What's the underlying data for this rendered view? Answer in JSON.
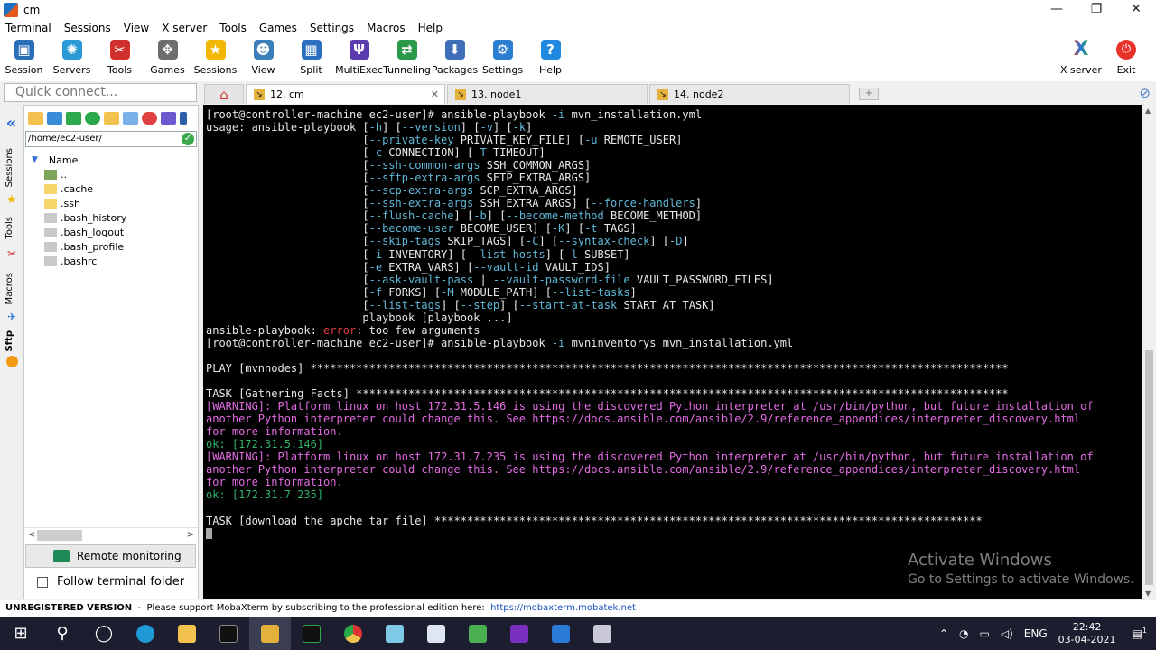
{
  "window": {
    "title": "cm",
    "minimize": "—",
    "maximize": "❐",
    "close": "✕"
  },
  "menu": [
    "Terminal",
    "Sessions",
    "View",
    "X server",
    "Tools",
    "Games",
    "Settings",
    "Macros",
    "Help"
  ],
  "toolbar": {
    "items": [
      {
        "label": "Session",
        "icon": "session-icon",
        "color": "#2a6fb5",
        "glyph": "▣"
      },
      {
        "label": "Servers",
        "icon": "servers-icon",
        "color": "#2b9bd6",
        "glyph": "✺"
      },
      {
        "label": "Tools",
        "icon": "tools-icon",
        "color": "#d0312d",
        "glyph": "✂"
      },
      {
        "label": "Games",
        "icon": "games-icon",
        "color": "#6e6e6e",
        "glyph": "✥"
      },
      {
        "label": "Sessions",
        "icon": "star-icon",
        "color": "#f2b705",
        "glyph": "★"
      },
      {
        "label": "View",
        "icon": "view-icon",
        "color": "#3d7fb8",
        "glyph": "☻"
      },
      {
        "label": "Split",
        "icon": "split-icon",
        "color": "#2b6fc0",
        "glyph": "▦"
      },
      {
        "label": "MultiExec",
        "icon": "multiexec-icon",
        "color": "#5b3bb0",
        "glyph": "Ψ"
      },
      {
        "label": "Tunneling",
        "icon": "tunneling-icon",
        "color": "#2a9a4a",
        "glyph": "⇄"
      },
      {
        "label": "Packages",
        "icon": "packages-icon",
        "color": "#3f6fb8",
        "glyph": "⬇"
      },
      {
        "label": "Settings",
        "icon": "settings-icon",
        "color": "#2c7fd0",
        "glyph": "⚙"
      },
      {
        "label": "Help",
        "icon": "help-icon",
        "color": "#1f8ae0",
        "glyph": "?"
      }
    ],
    "xserver_label": "X server",
    "exit_label": "Exit"
  },
  "quick_connect": {
    "placeholder": "Quick connect..."
  },
  "tabs": [
    {
      "label": "12. cm",
      "active": true,
      "close": "✕"
    },
    {
      "label": "13. node1",
      "active": false
    },
    {
      "label": "14. node2",
      "active": false
    }
  ],
  "side_labels": [
    "Sessions",
    "Tools",
    "Macros",
    "Sftp"
  ],
  "sftp": {
    "path": "/home/ec2-user/",
    "column": "Name",
    "files": [
      {
        "name": "..",
        "type": "up"
      },
      {
        "name": ".cache",
        "type": "folder"
      },
      {
        "name": ".ssh",
        "type": "folder"
      },
      {
        "name": ".bash_history",
        "type": "doc"
      },
      {
        "name": ".bash_logout",
        "type": "doc"
      },
      {
        "name": ".bash_profile",
        "type": "doc"
      },
      {
        "name": ".bashrc",
        "type": "doc"
      }
    ],
    "remote_monitoring": "Remote monitoring",
    "follow_folder": "Follow terminal folder"
  },
  "terminal": {
    "lines": [
      [
        {
          "t": "[root@controller-machine ec2-user]# ansible-playbook "
        },
        {
          "t": "-i",
          "c": "cyan"
        },
        {
          "t": " mvn_installation.yml"
        }
      ],
      [
        {
          "t": "usage: ansible-playbook ["
        },
        {
          "t": "-h",
          "c": "cyan"
        },
        {
          "t": "] ["
        },
        {
          "t": "--version",
          "c": "cyan"
        },
        {
          "t": "] ["
        },
        {
          "t": "-v",
          "c": "cyan"
        },
        {
          "t": "] ["
        },
        {
          "t": "-k",
          "c": "cyan"
        },
        {
          "t": "]"
        }
      ],
      [
        {
          "t": "                        ["
        },
        {
          "t": "--private-key",
          "c": "cyan"
        },
        {
          "t": " PRIVATE_KEY_FILE] ["
        },
        {
          "t": "-u",
          "c": "cyan"
        },
        {
          "t": " REMOTE_USER]"
        }
      ],
      [
        {
          "t": "                        ["
        },
        {
          "t": "-c",
          "c": "cyan"
        },
        {
          "t": " CONNECTION] ["
        },
        {
          "t": "-T",
          "c": "cyan"
        },
        {
          "t": " TIMEOUT]"
        }
      ],
      [
        {
          "t": "                        ["
        },
        {
          "t": "--ssh-common-args",
          "c": "cyan"
        },
        {
          "t": " SSH_COMMON_ARGS]"
        }
      ],
      [
        {
          "t": "                        ["
        },
        {
          "t": "--sftp-extra-args",
          "c": "cyan"
        },
        {
          "t": " SFTP_EXTRA_ARGS]"
        }
      ],
      [
        {
          "t": "                        ["
        },
        {
          "t": "--scp-extra-args",
          "c": "cyan"
        },
        {
          "t": " SCP_EXTRA_ARGS]"
        }
      ],
      [
        {
          "t": "                        ["
        },
        {
          "t": "--ssh-extra-args",
          "c": "cyan"
        },
        {
          "t": " SSH_EXTRA_ARGS] ["
        },
        {
          "t": "--force-handlers",
          "c": "cyan"
        },
        {
          "t": "]"
        }
      ],
      [
        {
          "t": "                        ["
        },
        {
          "t": "--flush-cache",
          "c": "cyan"
        },
        {
          "t": "] ["
        },
        {
          "t": "-b",
          "c": "cyan"
        },
        {
          "t": "] ["
        },
        {
          "t": "--become-method",
          "c": "cyan"
        },
        {
          "t": " BECOME_METHOD]"
        }
      ],
      [
        {
          "t": "                        ["
        },
        {
          "t": "--become-user",
          "c": "cyan"
        },
        {
          "t": " BECOME_USER] ["
        },
        {
          "t": "-K",
          "c": "cyan"
        },
        {
          "t": "] ["
        },
        {
          "t": "-t",
          "c": "cyan"
        },
        {
          "t": " TAGS]"
        }
      ],
      [
        {
          "t": "                        ["
        },
        {
          "t": "--skip-tags",
          "c": "cyan"
        },
        {
          "t": " SKIP_TAGS] ["
        },
        {
          "t": "-C",
          "c": "cyan"
        },
        {
          "t": "] ["
        },
        {
          "t": "--syntax-check",
          "c": "cyan"
        },
        {
          "t": "] ["
        },
        {
          "t": "-D",
          "c": "cyan"
        },
        {
          "t": "]"
        }
      ],
      [
        {
          "t": "                        ["
        },
        {
          "t": "-i",
          "c": "cyan"
        },
        {
          "t": " INVENTORY] ["
        },
        {
          "t": "--list-hosts",
          "c": "cyan"
        },
        {
          "t": "] ["
        },
        {
          "t": "-l",
          "c": "cyan"
        },
        {
          "t": " SUBSET]"
        }
      ],
      [
        {
          "t": "                        ["
        },
        {
          "t": "-e",
          "c": "cyan"
        },
        {
          "t": " EXTRA_VARS] ["
        },
        {
          "t": "--vault-id",
          "c": "cyan"
        },
        {
          "t": " VAULT_IDS]"
        }
      ],
      [
        {
          "t": "                        ["
        },
        {
          "t": "--ask-vault-pass",
          "c": "cyan"
        },
        {
          "t": " | "
        },
        {
          "t": "--vault-password-file",
          "c": "cyan"
        },
        {
          "t": " VAULT_PASSWORD_FILES]"
        }
      ],
      [
        {
          "t": "                        ["
        },
        {
          "t": "-f",
          "c": "cyan"
        },
        {
          "t": " FORKS] ["
        },
        {
          "t": "-M",
          "c": "cyan"
        },
        {
          "t": " MODULE_PATH] ["
        },
        {
          "t": "--list-tasks",
          "c": "cyan"
        },
        {
          "t": "]"
        }
      ],
      [
        {
          "t": "                        ["
        },
        {
          "t": "--list-tags",
          "c": "cyan"
        },
        {
          "t": "] ["
        },
        {
          "t": "--step",
          "c": "cyan"
        },
        {
          "t": "] ["
        },
        {
          "t": "--start-at-task",
          "c": "cyan"
        },
        {
          "t": " START_AT_TASK]"
        }
      ],
      [
        {
          "t": "                        playbook [playbook ...]"
        }
      ],
      [
        {
          "t": "ansible-playbook: "
        },
        {
          "t": "error",
          "c": "red"
        },
        {
          "t": ": too few arguments"
        }
      ],
      [
        {
          "t": "[root@controller-machine ec2-user]# ansible-playbook "
        },
        {
          "t": "-i",
          "c": "cyan"
        },
        {
          "t": " mvninventorys mvn_installation.yml"
        }
      ],
      [
        {
          "t": ""
        }
      ],
      [
        {
          "t": "PLAY [mvnnodes] ***********************************************************************************************************"
        }
      ],
      [
        {
          "t": ""
        }
      ],
      [
        {
          "t": "TASK [Gathering Facts] ****************************************************************************************************"
        }
      ],
      [
        {
          "t": "[WARNING]: Platform linux on host 172.31.5.146 is using the discovered Python interpreter at /usr/bin/python, but future installation of",
          "c": "mag"
        }
      ],
      [
        {
          "t": "another Python interpreter could change this. See https://docs.ansible.com/ansible/2.9/reference_appendices/interpreter_discovery.html",
          "c": "mag"
        }
      ],
      [
        {
          "t": "for more information.",
          "c": "mag"
        }
      ],
      [
        {
          "t": "ok: [172.31.5.146]",
          "c": "grn"
        }
      ],
      [
        {
          "t": "[WARNING]: Platform linux on host 172.31.7.235 is using the discovered Python interpreter at /usr/bin/python, but future installation of",
          "c": "mag"
        }
      ],
      [
        {
          "t": "another Python interpreter could change this. See https://docs.ansible.com/ansible/2.9/reference_appendices/interpreter_discovery.html",
          "c": "mag"
        }
      ],
      [
        {
          "t": "for more information.",
          "c": "mag"
        }
      ],
      [
        {
          "t": "ok: [172.31.7.235]",
          "c": "grn"
        }
      ],
      [
        {
          "t": ""
        }
      ],
      [
        {
          "t": "TASK [download the apche tar file] ************************************************************************************"
        }
      ]
    ]
  },
  "watermark": {
    "title": "Activate Windows",
    "subtitle": "Go to Settings to activate Windows."
  },
  "status": {
    "bold": "UNREGISTERED VERSION",
    "text": "  -  Please support MobaXterm by subscribing to the professional edition here:  ",
    "link": "https://mobaxterm.mobatek.net"
  },
  "taskbar": {
    "lang": "ENG",
    "time": "22:42",
    "date": "03-04-2021",
    "notifications": "1"
  }
}
